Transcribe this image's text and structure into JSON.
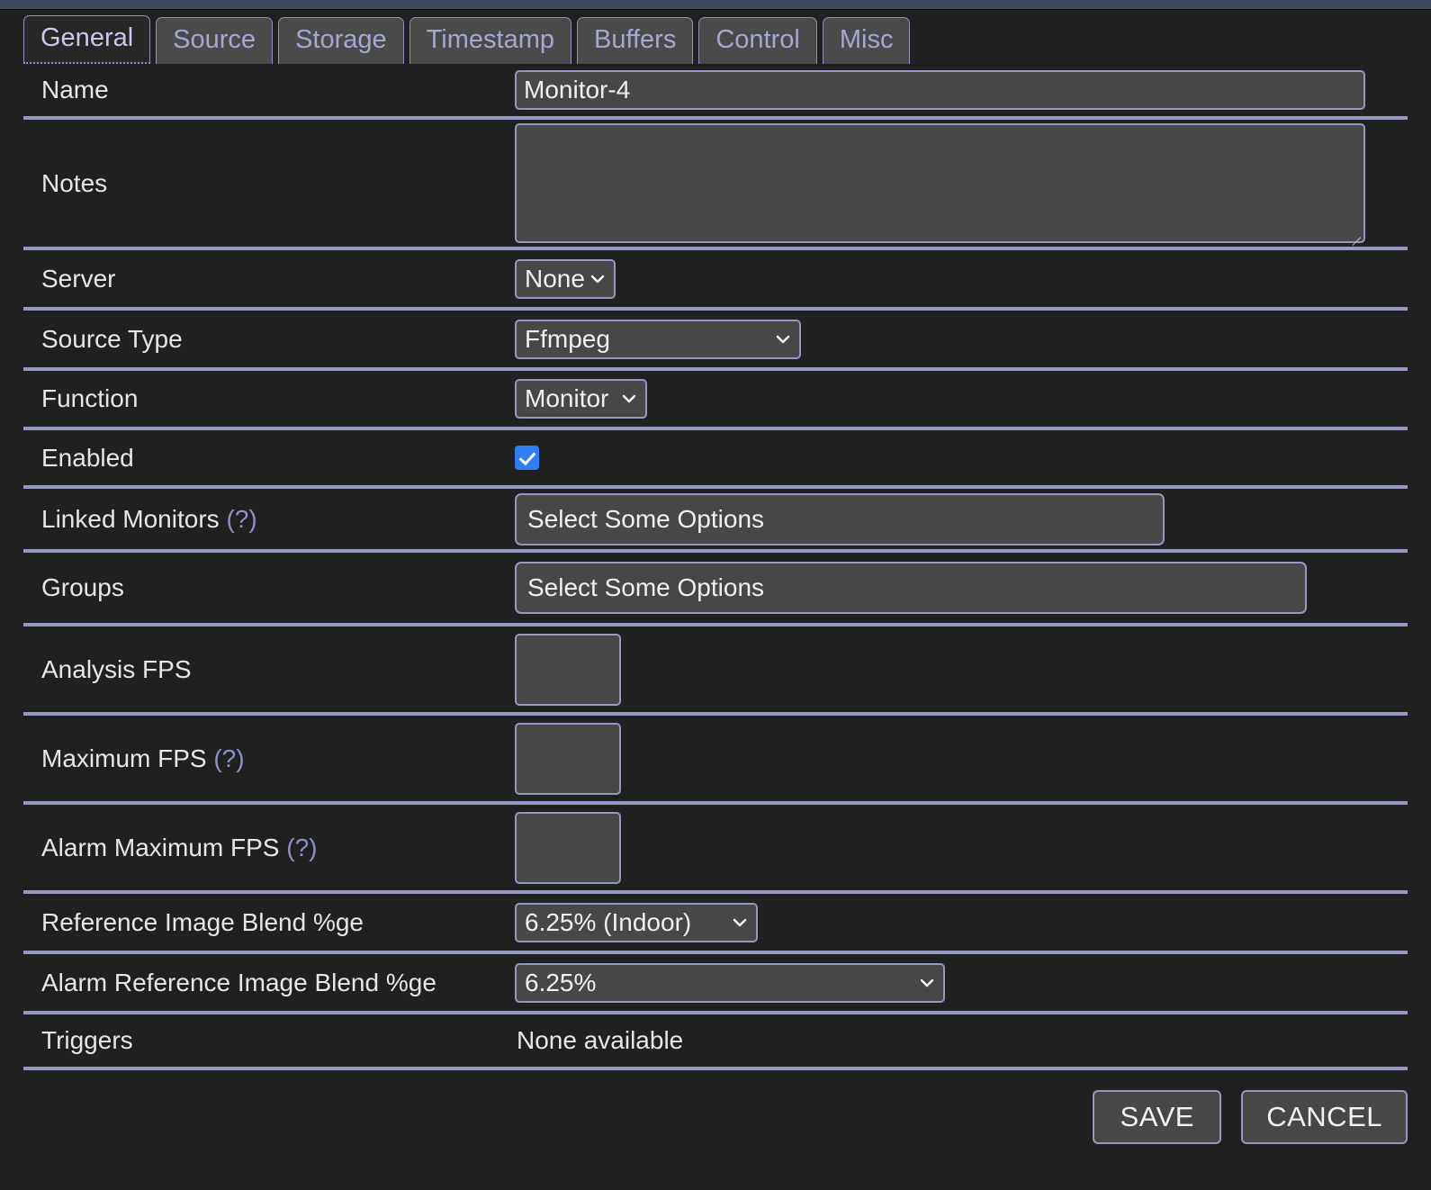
{
  "window": {
    "topbar_color": "#3d4a5c",
    "background_color": "#202020",
    "accent_color": "#9698c4",
    "field_background": "#474747",
    "checkbox_color": "#2f7ef4"
  },
  "tabs": [
    {
      "label": "General",
      "active": true
    },
    {
      "label": "Source",
      "active": false
    },
    {
      "label": "Storage",
      "active": false
    },
    {
      "label": "Timestamp",
      "active": false
    },
    {
      "label": "Buffers",
      "active": false
    },
    {
      "label": "Control",
      "active": false
    },
    {
      "label": "Misc",
      "active": false
    }
  ],
  "form": {
    "name": {
      "label": "Name",
      "value": "Monitor-4",
      "placeholder": ""
    },
    "notes": {
      "label": "Notes",
      "value": "",
      "placeholder": ""
    },
    "server": {
      "label": "Server",
      "value": "None"
    },
    "source_type": {
      "label": "Source Type",
      "value": "Ffmpeg"
    },
    "function": {
      "label": "Function",
      "value": "Monitor"
    },
    "enabled": {
      "label": "Enabled",
      "checked": true
    },
    "linked_monitors": {
      "label": "Linked Monitors",
      "hint": "(?)",
      "value": "Select Some Options"
    },
    "groups": {
      "label": "Groups",
      "value": "Select Some Options"
    },
    "analysis_fps": {
      "label": "Analysis FPS",
      "value": "",
      "placeholder": ""
    },
    "maximum_fps": {
      "label": "Maximum FPS",
      "hint": "(?)",
      "value": "",
      "placeholder": ""
    },
    "alarm_maximum_fps": {
      "label": "Alarm Maximum FPS",
      "hint": "(?)",
      "value": "",
      "placeholder": ""
    },
    "reference_blend": {
      "label": "Reference Image Blend %ge",
      "value": "6.25% (Indoor)"
    },
    "alarm_reference_blend": {
      "label": "Alarm Reference Image Blend %ge",
      "value": "6.25%"
    },
    "triggers": {
      "label": "Triggers",
      "value": "None available"
    }
  },
  "actions": {
    "save_label": "SAVE",
    "cancel_label": "CANCEL"
  }
}
